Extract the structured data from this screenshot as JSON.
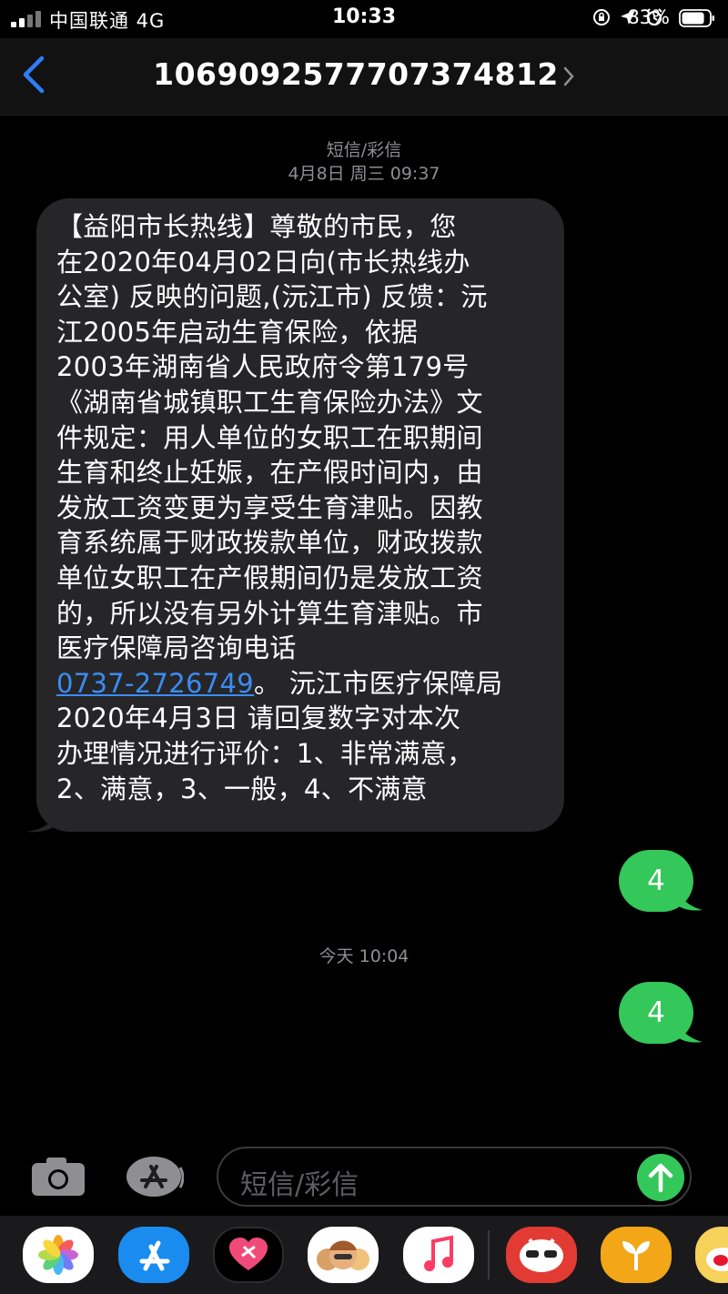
{
  "status_bar": {
    "carrier": "中国联通  4G",
    "time": "10:33",
    "battery_percent": "83%",
    "battery_level": 0.83,
    "icons": [
      "lock-rotation-icon",
      "location-arrow-icon",
      "alarm-icon",
      "battery-icon"
    ]
  },
  "header": {
    "back_icon": "chevron-left-icon",
    "contact_number": "106909257770737481 2",
    "contact_display": "1069092577707374812",
    "chevron_icon": "chevron-right-icon"
  },
  "thread": {
    "first_meta_type": "短信/彩信",
    "first_meta_time": "4月8日 周三 09:37",
    "incoming_message": {
      "line_1": "【益阳市长热线】尊敬的市民，您",
      "line_2": "在2020年04月02日向(市长热线办",
      "line_3": "公室) 反映的问题,(沅江市) 反馈：沅",
      "line_4": "江2005年启动生育保险，依据",
      "line_5": "2003年湖南省人民政府令第179号",
      "line_6": "《湖南省城镇职工生育保险办法》文",
      "line_7": "件规定：用人单位的女职工在职期间",
      "line_8": "生育和终止妊娠，在产假时间内，由",
      "line_9": "发放工资变更为享受生育津贴。因教",
      "line_10": "育系统属于财政拨款单位，财政拨款",
      "line_11": "单位女职工在产假期间仍是发放工资",
      "line_12": "的，所以没有另外计算生育津贴。市",
      "line_13": "医疗保障局咨询电话",
      "phone_link": "0737-2726749",
      "line_14_rest": "。 沅江市医疗保障局",
      "line_15": "2020年4月3日 请回复数字对本次",
      "line_16": "办理情况进行评价：1、非常满意，",
      "line_17": "2、满意，3、一般，4、不满意"
    },
    "reply_1": "4",
    "second_meta_time": "今天 10:04",
    "reply_2": "4"
  },
  "compose": {
    "placeholder": "短信/彩信",
    "camera_icon": "camera-icon",
    "apps_icon": "app-store-icon",
    "send_icon": "send-arrow-icon"
  },
  "app_drawer": {
    "apps": [
      {
        "name": "photos-app-icon"
      },
      {
        "name": "app-store-app-icon"
      },
      {
        "name": "digital-touch-app-icon"
      },
      {
        "name": "memoji-app-icon"
      },
      {
        "name": "music-app-icon"
      },
      {
        "name": "red-panda-app-icon"
      },
      {
        "name": "green-sprout-app-icon"
      },
      {
        "name": "weibo-app-icon"
      }
    ]
  }
}
